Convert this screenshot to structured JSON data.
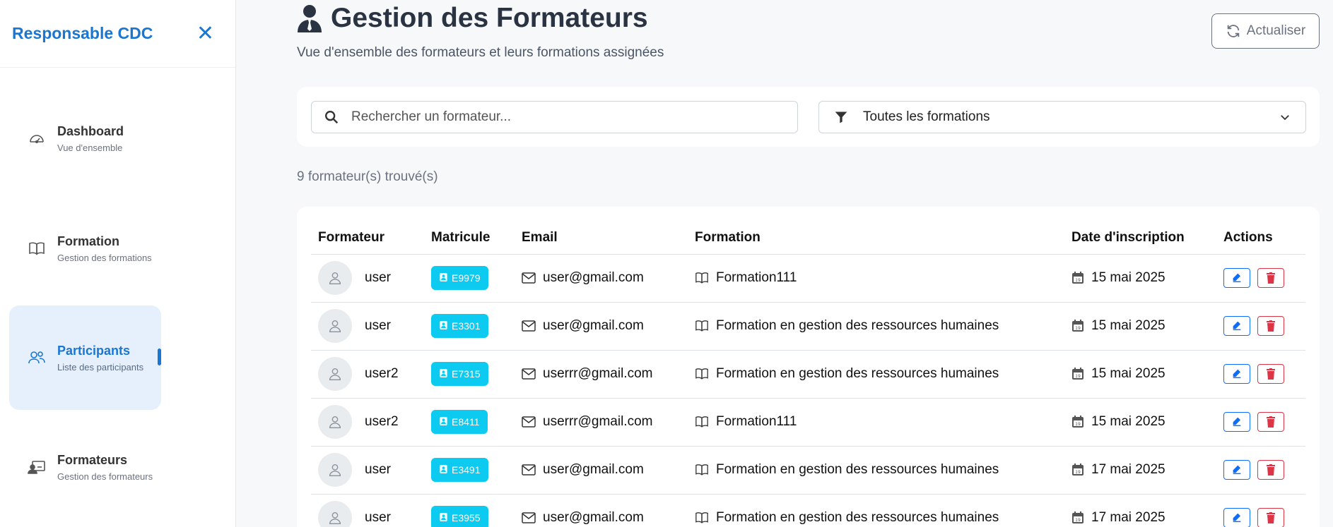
{
  "sidebar": {
    "brand": "Responsable CDC",
    "items": [
      {
        "label": "Dashboard",
        "sub": "Vue d'ensemble",
        "icon": "dashboard-gauge-icon"
      },
      {
        "label": "Formation",
        "sub": "Gestion des formations",
        "icon": "book-icon"
      },
      {
        "label": "Participants",
        "sub": "Liste des participants",
        "icon": "users-icon",
        "active": true
      },
      {
        "label": "Formateurs",
        "sub": "Gestion des formateurs",
        "icon": "teacher-icon"
      }
    ]
  },
  "header": {
    "title": "Gestion des Formateurs",
    "subtitle": "Vue d'ensemble des formateurs et leurs formations assignées",
    "refresh_label": "Actualiser"
  },
  "filters": {
    "search_placeholder": "Rechercher un formateur...",
    "formation_selected": "Toutes les formations"
  },
  "result_count": "9 formateur(s) trouvé(s)",
  "table": {
    "columns": [
      "Formateur",
      "Matricule",
      "Email",
      "Formation",
      "Date d'inscription",
      "Actions"
    ],
    "rows": [
      {
        "name": "user",
        "matricule": "E9979",
        "email": "user@gmail.com",
        "formation": "Formation111",
        "date": "15 mai 2025"
      },
      {
        "name": "user",
        "matricule": "E3301",
        "email": "user@gmail.com",
        "formation": "Formation en gestion des ressources humaines",
        "date": "15 mai 2025"
      },
      {
        "name": "user2",
        "matricule": "E7315",
        "email": "userrr@gmail.com",
        "formation": "Formation en gestion des ressources humaines",
        "date": "15 mai 2025"
      },
      {
        "name": "user2",
        "matricule": "E8411",
        "email": "userrr@gmail.com",
        "formation": "Formation111",
        "date": "15 mai 2025"
      },
      {
        "name": "user",
        "matricule": "E3491",
        "email": "user@gmail.com",
        "formation": "Formation en gestion des ressources humaines",
        "date": "17 mai 2025"
      },
      {
        "name": "user",
        "matricule": "E3955",
        "email": "user@gmail.com",
        "formation": "Formation en gestion des ressources humaines",
        "date": "17 mai 2025"
      }
    ]
  },
  "colors": {
    "accent": "#1976d2",
    "badge": "#0dcaf0",
    "edit": "#0d6efd",
    "delete": "#dc3545"
  }
}
